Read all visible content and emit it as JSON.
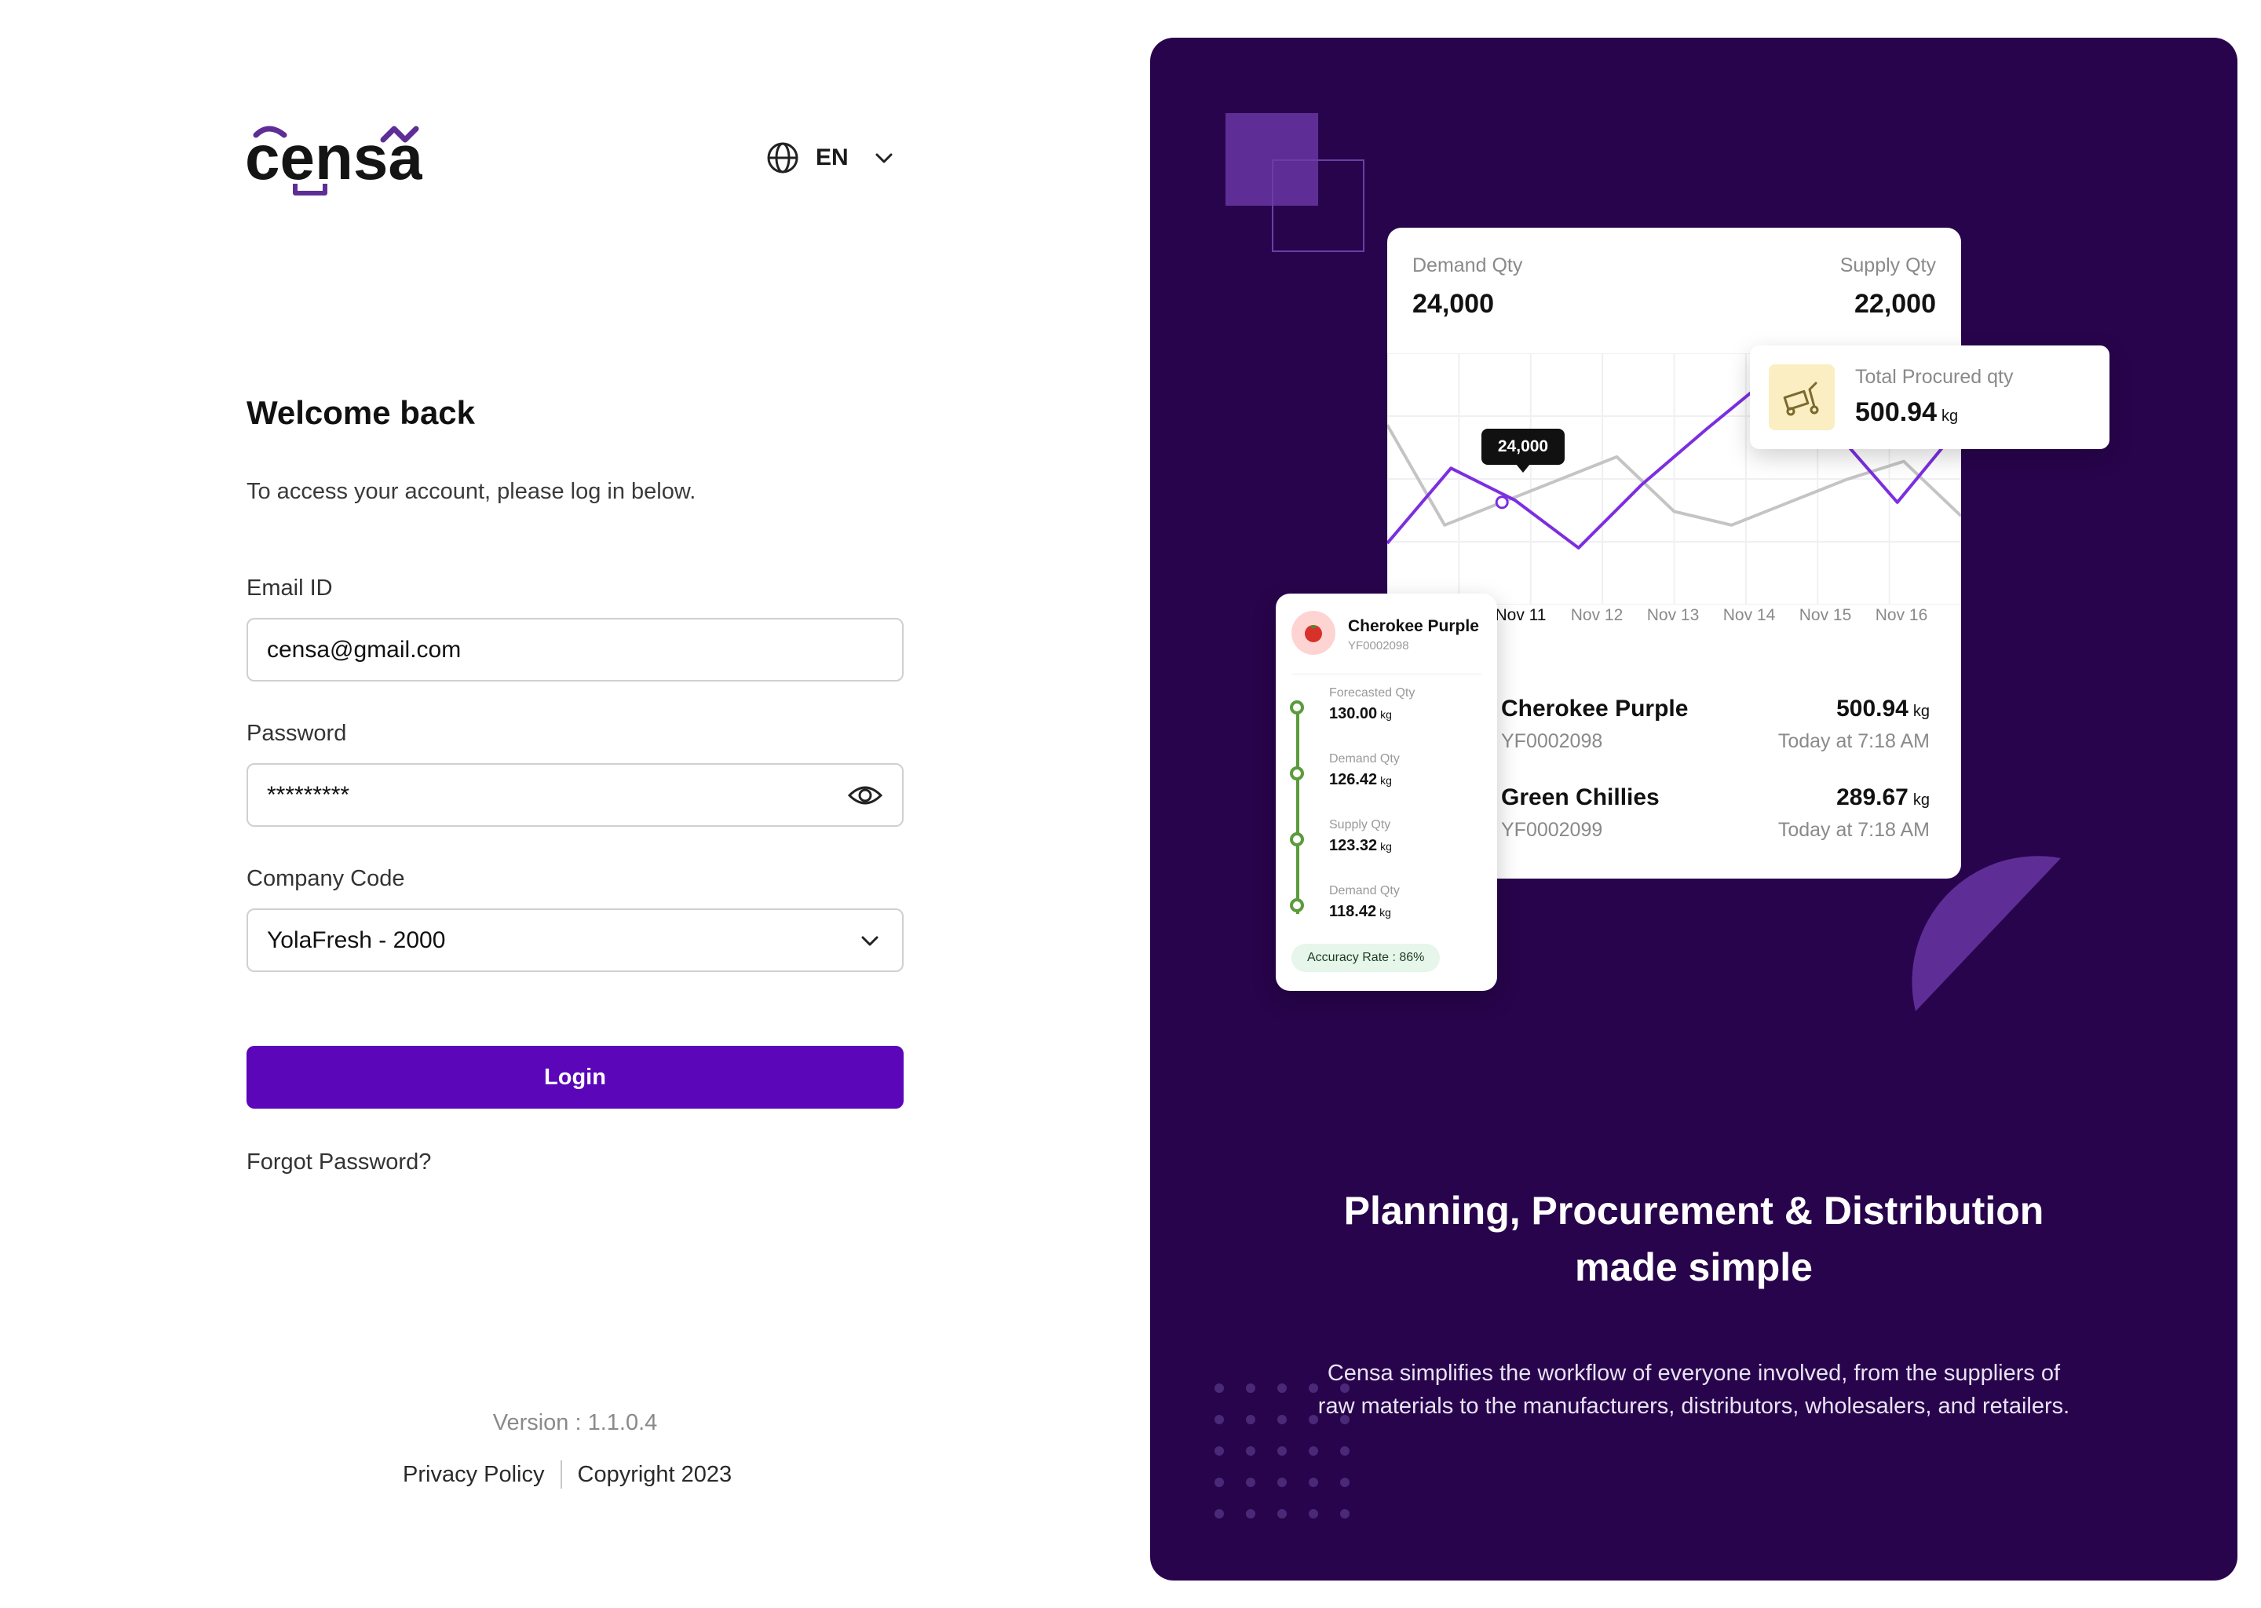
{
  "brand": {
    "logo_text": "censa",
    "accent_color": "#5b06b9",
    "panel_color": "#28044c"
  },
  "language": {
    "icon": "globe-icon",
    "label": "EN"
  },
  "login": {
    "title": "Welcome back",
    "subtitle": "To access your account, please log in below.",
    "email": {
      "label": "Email ID",
      "value": "censa@gmail.com"
    },
    "password": {
      "label": "Password",
      "value": "*********",
      "toggle_icon": "eye-icon"
    },
    "company": {
      "label": "Company Code",
      "value": "YolaFresh - 2000"
    },
    "submit_label": "Login",
    "forgot_label": "Forgot Password?"
  },
  "footer": {
    "version": "Version : 1.1.0.4",
    "privacy": "Privacy Policy",
    "copyright": "Copyright 2023"
  },
  "promo": {
    "demand": {
      "label": "Demand Qty",
      "value": "24,000"
    },
    "supply": {
      "label": "Supply Qty",
      "value": "22,000"
    },
    "tooltip": "24,000",
    "procured": {
      "label": "Total Procured qty",
      "value": "500.94",
      "unit": "kg",
      "icon": "trolley-icon"
    },
    "dates": [
      "Nov 11",
      "Nov 12",
      "Nov 13",
      "Nov 14",
      "Nov 15",
      "Nov 16"
    ],
    "products": [
      {
        "name": "Cherokee Purple",
        "code": "YF0002098",
        "qty": "500.94",
        "unit": "kg",
        "time": "Today at 7:18 AM"
      },
      {
        "name": "Green Chillies",
        "code": "YF0002099",
        "qty": "289.67",
        "unit": "kg",
        "time": "Today at 7:18 AM"
      }
    ],
    "detail": {
      "name": "Cherokee Purple",
      "code": "YF0002098",
      "icon": "tomato-icon",
      "steps": [
        {
          "label": "Forecasted Qty",
          "value": "130.00",
          "unit": "kg"
        },
        {
          "label": "Demand Qty",
          "value": "126.42",
          "unit": "kg"
        },
        {
          "label": "Supply Qty",
          "value": "123.32",
          "unit": "kg"
        },
        {
          "label": "Demand Qty",
          "value": "118.42",
          "unit": "kg"
        }
      ],
      "badge": "Accuracy Rate : 86%"
    },
    "headline_line1": "Planning, Procurement & Distribution",
    "headline_line2": "made simple",
    "description_line1": "Censa simplifies the workflow of everyone involved, from the suppliers of",
    "description_line2": "raw materials to the manufacturers, distributors, wholesalers, and retailers."
  },
  "chart_data": {
    "type": "line",
    "ylim": [
      0,
      1
    ],
    "grid": true,
    "series": [
      {
        "color": "#7c2ee0",
        "values": [
          0.2,
          0.53,
          0.39,
          0.18,
          0.46,
          0.7,
          0.93,
          0.7,
          0.38,
          0.72
        ]
      },
      {
        "color": "#c4c4c4",
        "values": [
          0.72,
          0.28,
          0.38,
          0.48,
          0.58,
          0.34,
          0.28,
          0.38,
          0.48,
          0.56,
          0.32
        ]
      }
    ]
  }
}
